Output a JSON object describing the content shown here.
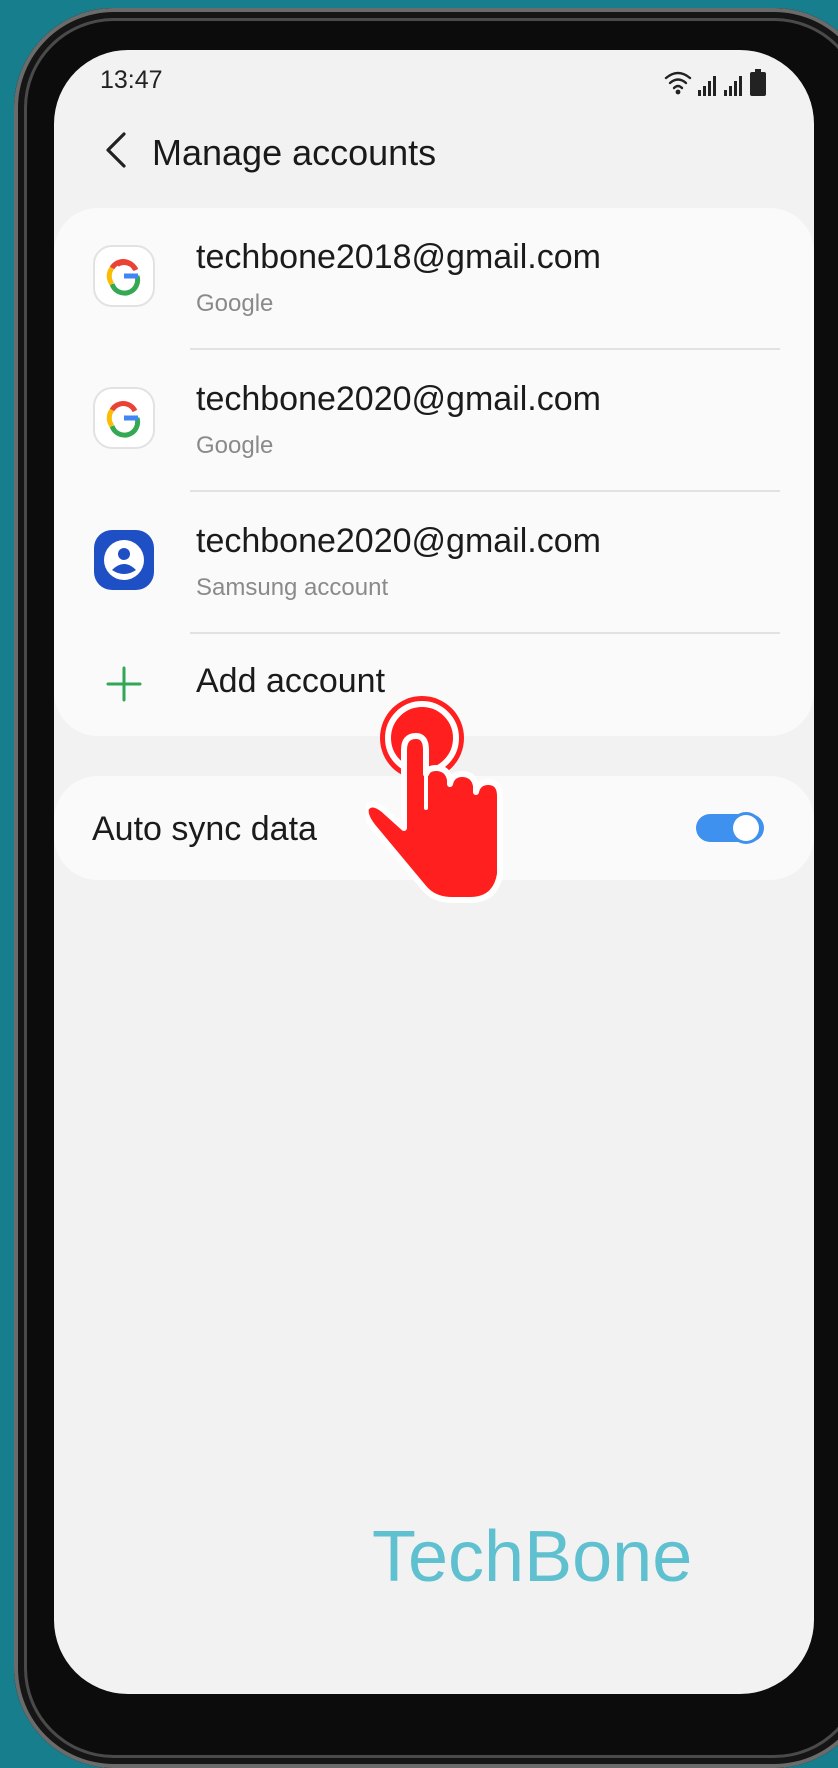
{
  "status_bar": {
    "time": "13:47"
  },
  "header": {
    "title": "Manage accounts"
  },
  "accounts": [
    {
      "email": "techbone2018@gmail.com",
      "type": "Google",
      "icon": "google-icon"
    },
    {
      "email": "techbone2020@gmail.com",
      "type": "Google",
      "icon": "google-icon"
    },
    {
      "email": "techbone2020@gmail.com",
      "type": "Samsung account",
      "icon": "samsung-account-icon"
    }
  ],
  "add_account": {
    "label": "Add account",
    "icon": "plus-icon"
  },
  "sync": {
    "label": "Auto sync data",
    "enabled": true
  },
  "watermark": "TechBone",
  "colors": {
    "accent_blue": "#3e91ee",
    "samsung_blue": "#1f4fc4",
    "plus_green": "#2fa856",
    "pointer_red": "#ff1f1f",
    "watermark": "#5fc0cf"
  }
}
